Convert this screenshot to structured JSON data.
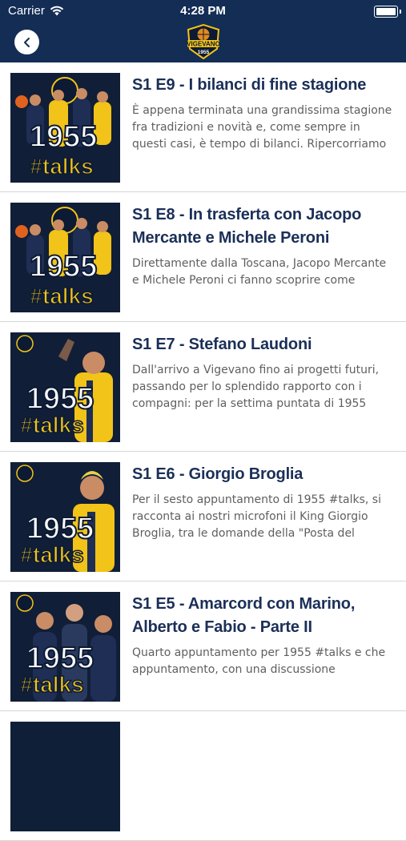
{
  "status_bar": {
    "carrier": "Carrier",
    "time": "4:28 PM"
  },
  "header": {
    "logo_text": "VIGEVANO",
    "logo_year": "1955"
  },
  "thumbnail": {
    "big_text": "1955",
    "tag_text": "#talks"
  },
  "episodes": [
    {
      "title": "S1 E9 - I bilanci di fine stagione",
      "description": "È appena terminata una grandissima stagione fra tradizioni e novità e, come sempre in questi casi, è tempo di bilanci. Ripercorriamo un'indi..."
    },
    {
      "title": "S1 E8 - In trasferta con Jacopo Mercante e Michele Peroni",
      "description": "Direttamente dalla Toscana, Jacopo Mercante e Michele Peroni ci fanno scoprire come Vigevan..."
    },
    {
      "title": "S1 E7 - Stefano Laudoni",
      "description": "Dall'arrivo a Vigevano fino ai progetti futuri, passando per lo splendido rapporto con i compagni: per la settima puntata di 1955 #talk..."
    },
    {
      "title": "S1 E6 - Giorgio Broglia",
      "description": "Per il sesto appuntamento di 1955 #talks, si racconta ai nostri microfoni il King Giorgio Broglia, tra le domande della \"Posta del cuore\"..."
    },
    {
      "title": "S1 E5 - Amarcord con Marino, Alberto e Fabio - Parte II",
      "description": "Quarto appuntamento per 1955 #talks e che appuntamento, con una discussione amarcord..."
    }
  ]
}
